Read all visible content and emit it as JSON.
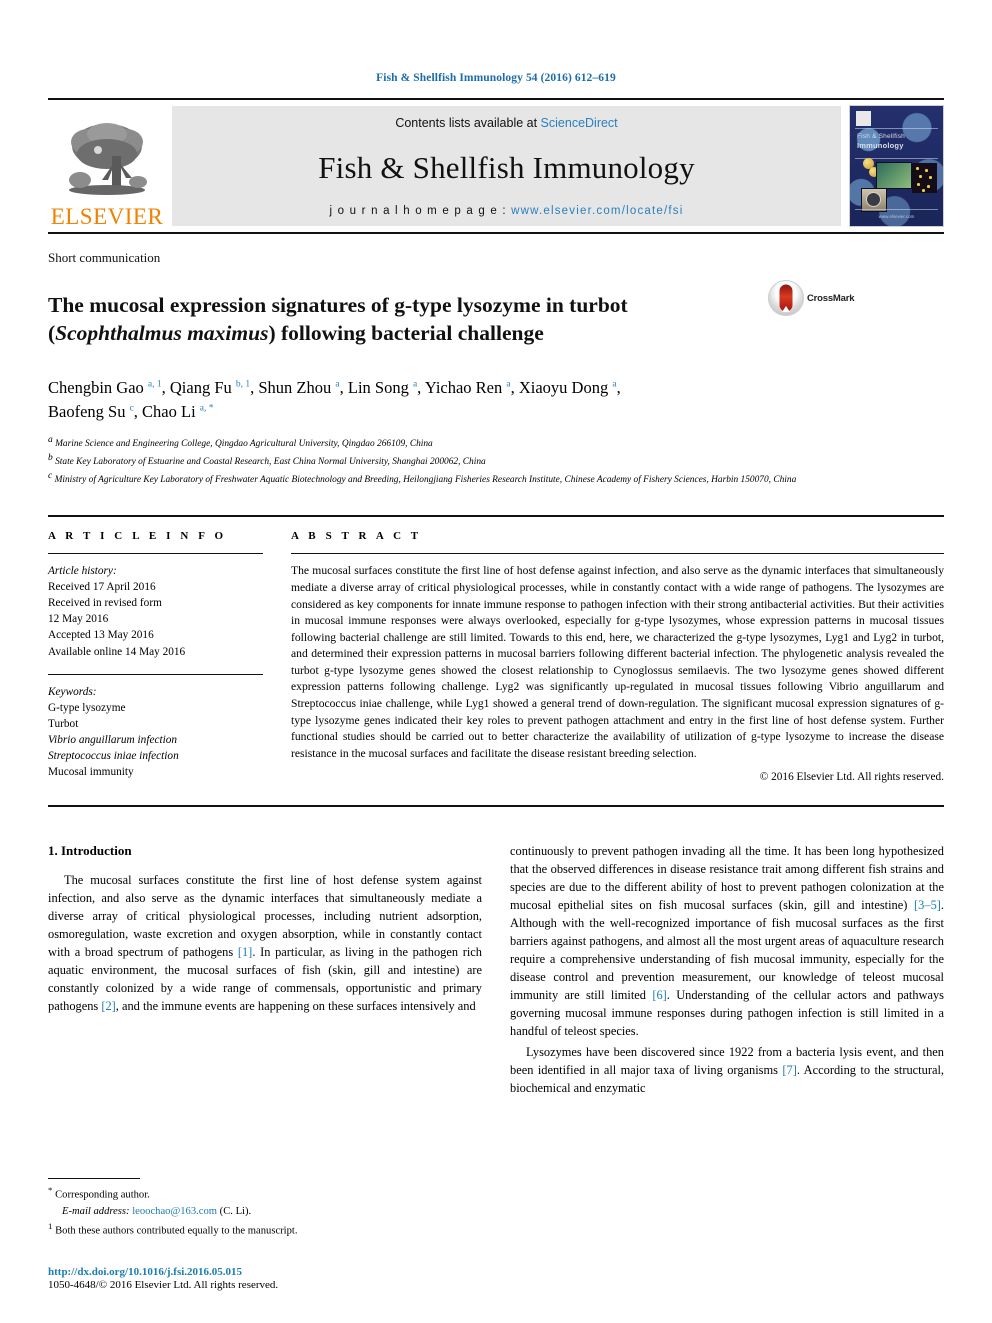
{
  "running_head": "Fish & Shellfish Immunology 54 (2016) 612–619",
  "masthead": {
    "contents_prefix": "Contents lists available at ",
    "sciencedirect": "ScienceDirect",
    "journal_title": "Fish & Shellfish Immunology",
    "homepage_prefix": "j o u r n a l   h o m e p a g e :  ",
    "homepage_url": "www.elsevier.com/locate/fsi",
    "elsevier_wordmark": "ELSEVIER",
    "cover": {
      "line1": "Fish & Shellfish",
      "line2": "Immunology",
      "footer": "www.elsevier.com"
    }
  },
  "article": {
    "type": "Short communication",
    "title_line1": "The mucosal expression signatures of g-type lysozyme in turbot",
    "title_italic": "Scophthalmus maximus",
    "title_line2_prefix": "(",
    "title_line2_suffix": ") following bacterial challenge",
    "crossmark_label": "CrossMark",
    "authors": [
      {
        "name": "Chengbin Gao",
        "marks": "a, 1"
      },
      {
        "name": "Qiang Fu",
        "marks": "b, 1"
      },
      {
        "name": "Shun Zhou",
        "marks": "a"
      },
      {
        "name": "Lin Song",
        "marks": "a"
      },
      {
        "name": "Yichao Ren",
        "marks": "a"
      },
      {
        "name": "Xiaoyu Dong",
        "marks": "a"
      },
      {
        "name": "Baofeng Su",
        "marks": "c"
      },
      {
        "name": "Chao Li",
        "marks": "a, *"
      }
    ],
    "affiliations": [
      {
        "mark": "a",
        "text": "Marine Science and Engineering College, Qingdao Agricultural University, Qingdao 266109, China"
      },
      {
        "mark": "b",
        "text": "State Key Laboratory of Estuarine and Coastal Research, East China Normal University, Shanghai 200062, China"
      },
      {
        "mark": "c",
        "text": "Ministry of Agriculture Key Laboratory of Freshwater Aquatic Biotechnology and Breeding, Heilongjiang Fisheries Research Institute, Chinese Academy of Fishery Sciences, Harbin 150070, China"
      }
    ]
  },
  "article_info": {
    "heading": "A R T I C L E   I N F O",
    "history_label": "Article history:",
    "history": [
      "Received 17 April 2016",
      "Received in revised form",
      "12 May 2016",
      "Accepted 13 May 2016",
      "Available online 14 May 2016"
    ],
    "keywords_label": "Keywords:",
    "keywords": [
      "G-type lysozyme",
      "Turbot",
      "Vibrio anguillarum infection",
      "Streptococcus iniae infection",
      "Mucosal immunity"
    ]
  },
  "abstract": {
    "heading": "A B S T R A C T",
    "text": "The mucosal surfaces constitute the first line of host defense against infection, and also serve as the dynamic interfaces that simultaneously mediate a diverse array of critical physiological processes, while in constantly contact with a wide range of pathogens. The lysozymes are considered as key components for innate immune response to pathogen infection with their strong antibacterial activities. But their activities in mucosal immune responses were always overlooked, especially for g-type lysozymes, whose expression patterns in mucosal tissues following bacterial challenge are still limited. Towards to this end, here, we characterized the g-type lysozymes, Lyg1 and Lyg2 in turbot, and determined their expression patterns in mucosal barriers following different bacterial infection. The phylogenetic analysis revealed the turbot g-type lysozyme genes showed the closest relationship to Cynoglossus semilaevis. The two lysozyme genes showed different expression patterns following challenge. Lyg2 was significantly up-regulated in mucosal tissues following Vibrio anguillarum and Streptococcus iniae challenge, while Lyg1 showed a general trend of down-regulation. The significant mucosal expression signatures of g-type lysozyme genes indicated their key roles to prevent pathogen attachment and entry in the first line of host defense system. Further functional studies should be carried out to better characterize the availability of utilization of g-type lysozyme to increase the disease resistance in the mucosal surfaces and facilitate the disease resistant breeding selection.",
    "copyright": "© 2016 Elsevier Ltd. All rights reserved."
  },
  "introduction": {
    "heading": "1.  Introduction",
    "left_para1_a": "The mucosal surfaces constitute the first line of host defense system against infection, and also serve as the dynamic interfaces that simultaneously mediate a diverse array of critical physiological processes, including nutrient adsorption, osmoregulation, waste excretion and oxygen absorption, while in constantly contact with a broad spectrum of pathogens ",
    "ref1": "[1]",
    "left_para1_b": ". In particular, as living in the pathogen rich aquatic environment, the mucosal surfaces of fish (skin, gill and intestine) are constantly colonized by a wide range of commensals, opportunistic and primary pathogens ",
    "ref2": "[2]",
    "left_para1_c": ", and the immune events are happening on these surfaces intensively and",
    "right_para1_a": "continuously to prevent pathogen invading all the time. It has been long hypothesized that the observed differences in disease resistance trait among different fish strains and species are due to the different ability of host to prevent pathogen colonization at the mucosal epithelial sites on fish mucosal surfaces (skin, gill and intestine) ",
    "ref3": "[3–5]",
    "right_para1_b": ". Although with the well-recognized importance of fish mucosal surfaces as the first barriers against pathogens, and almost all the most urgent areas of aquaculture research require a comprehensive understanding of fish mucosal immunity, especially for the disease control and prevention measurement, our knowledge of teleost mucosal immunity are still limited ",
    "ref6": "[6]",
    "right_para1_c": ". Understanding of the cellular actors and pathways governing mucosal immune responses during pathogen infection is still limited in a handful of teleost species.",
    "right_para2_a": "Lysozymes have been discovered since 1922 from a bacteria lysis event, and then been identified in all major taxa of living organisms ",
    "ref7": "[7]",
    "right_para2_b": ". According to the structural, biochemical and enzymatic"
  },
  "footnotes": {
    "corresponding_mark": "*",
    "corresponding_text": "Corresponding author.",
    "email_label": "E-mail address:",
    "email": "leoochao@163.com",
    "email_suffix": "(C. Li).",
    "equal_mark": "1",
    "equal_text": "Both these authors contributed equally to the manuscript."
  },
  "footer": {
    "doi": "http://dx.doi.org/10.1016/j.fsi.2016.05.015",
    "issn": "1050-4648/© 2016 Elsevier Ltd. All rights reserved."
  },
  "colors": {
    "link": "#1b7db0",
    "elsevier_orange": "#ef8200",
    "sciencedirect_blue": "#2a7fbd"
  }
}
